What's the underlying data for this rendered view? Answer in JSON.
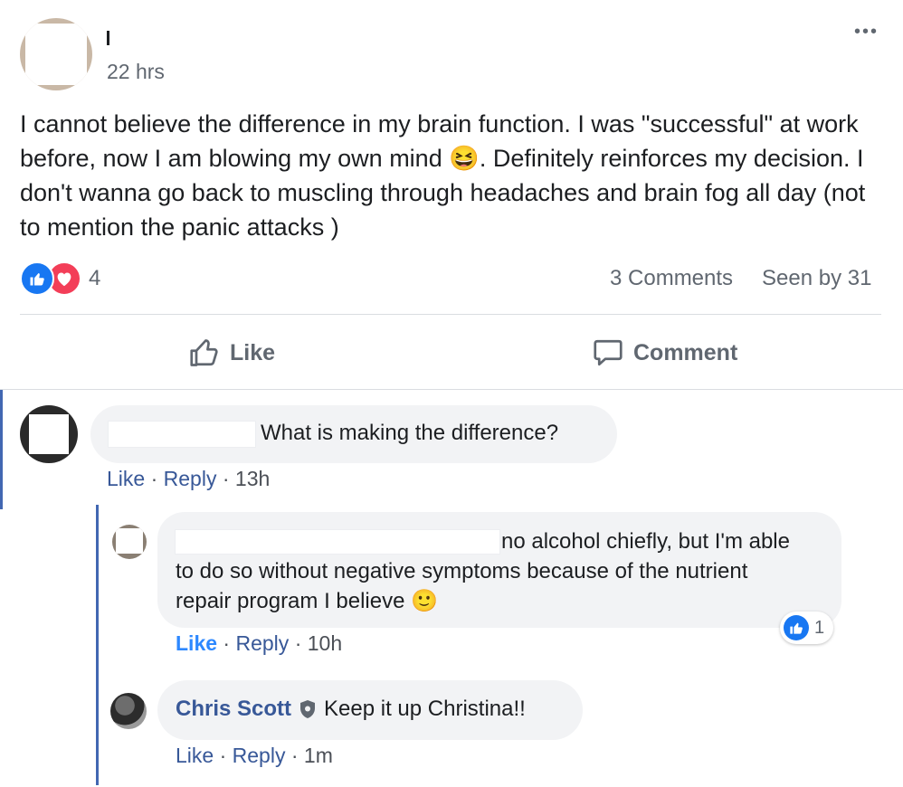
{
  "post": {
    "timestamp": "22 hrs",
    "body_text": "I cannot believe the difference in my brain function. I was \"successful\" at work before, now I am blowing my own mind 😆. Definitely reinforces my decision. I don't wanna go back to muscling through headaches and brain fog all day (not to mention the panic attacks )",
    "reaction_count": "4",
    "comments_count": "3 Comments",
    "seen_by": "Seen by 31",
    "like_label": "Like",
    "comment_label": "Comment",
    "more_glyph": "•••"
  },
  "comments": [
    {
      "text": "What is making the difference?",
      "like": "Like",
      "reply": "Reply",
      "sep": "·",
      "time": "13h"
    },
    {
      "text": "no alcohol chiefly, but I'm able to do so without negative symptoms because of the nutrient repair program I believe 🙂",
      "like": "Like",
      "reply": "Reply",
      "sep": "·",
      "time": "10h",
      "reaction_count": "1"
    },
    {
      "author": "Chris Scott",
      "text": "Keep it up Christina!!",
      "like": "Like",
      "reply": "Reply",
      "sep": "·",
      "time": "1m"
    }
  ],
  "colors": {
    "accent": "#1877f2",
    "love": "#f33e58",
    "bubble": "#f2f3f5",
    "thread_line": "#4267b2"
  }
}
